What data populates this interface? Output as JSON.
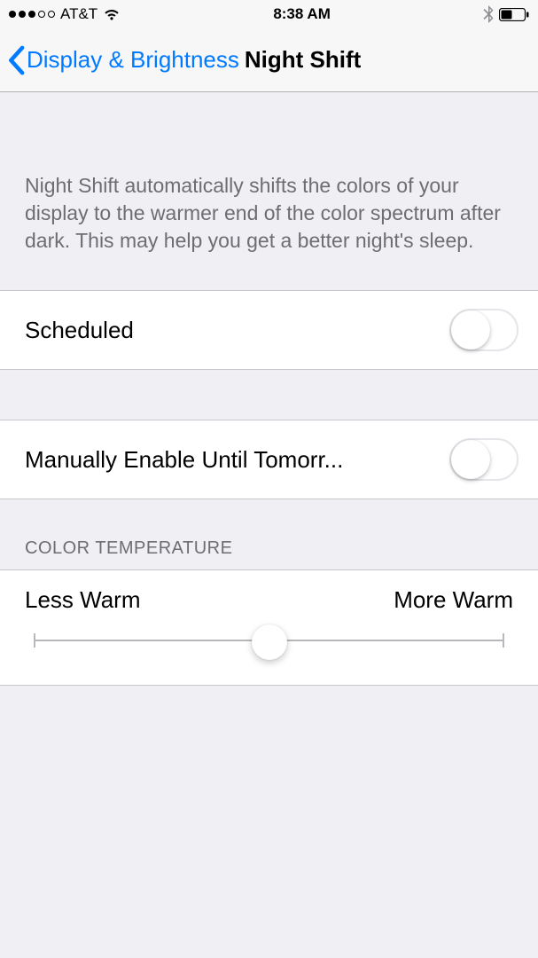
{
  "status_bar": {
    "signal_filled": 3,
    "signal_total": 5,
    "carrier": "AT&T",
    "time": "8:38 AM"
  },
  "nav": {
    "back_label": "Display & Brightness",
    "title": "Night Shift"
  },
  "description": "Night Shift automatically shifts the colors of your display to the warmer end of the color spectrum after dark. This may help you get a better night's sleep.",
  "rows": {
    "scheduled_label": "Scheduled",
    "scheduled_on": false,
    "manual_label": "Manually Enable Until Tomorr...",
    "manual_on": false
  },
  "color_temp": {
    "header": "COLOR TEMPERATURE",
    "less_label": "Less Warm",
    "more_label": "More Warm",
    "value_percent": 50
  }
}
